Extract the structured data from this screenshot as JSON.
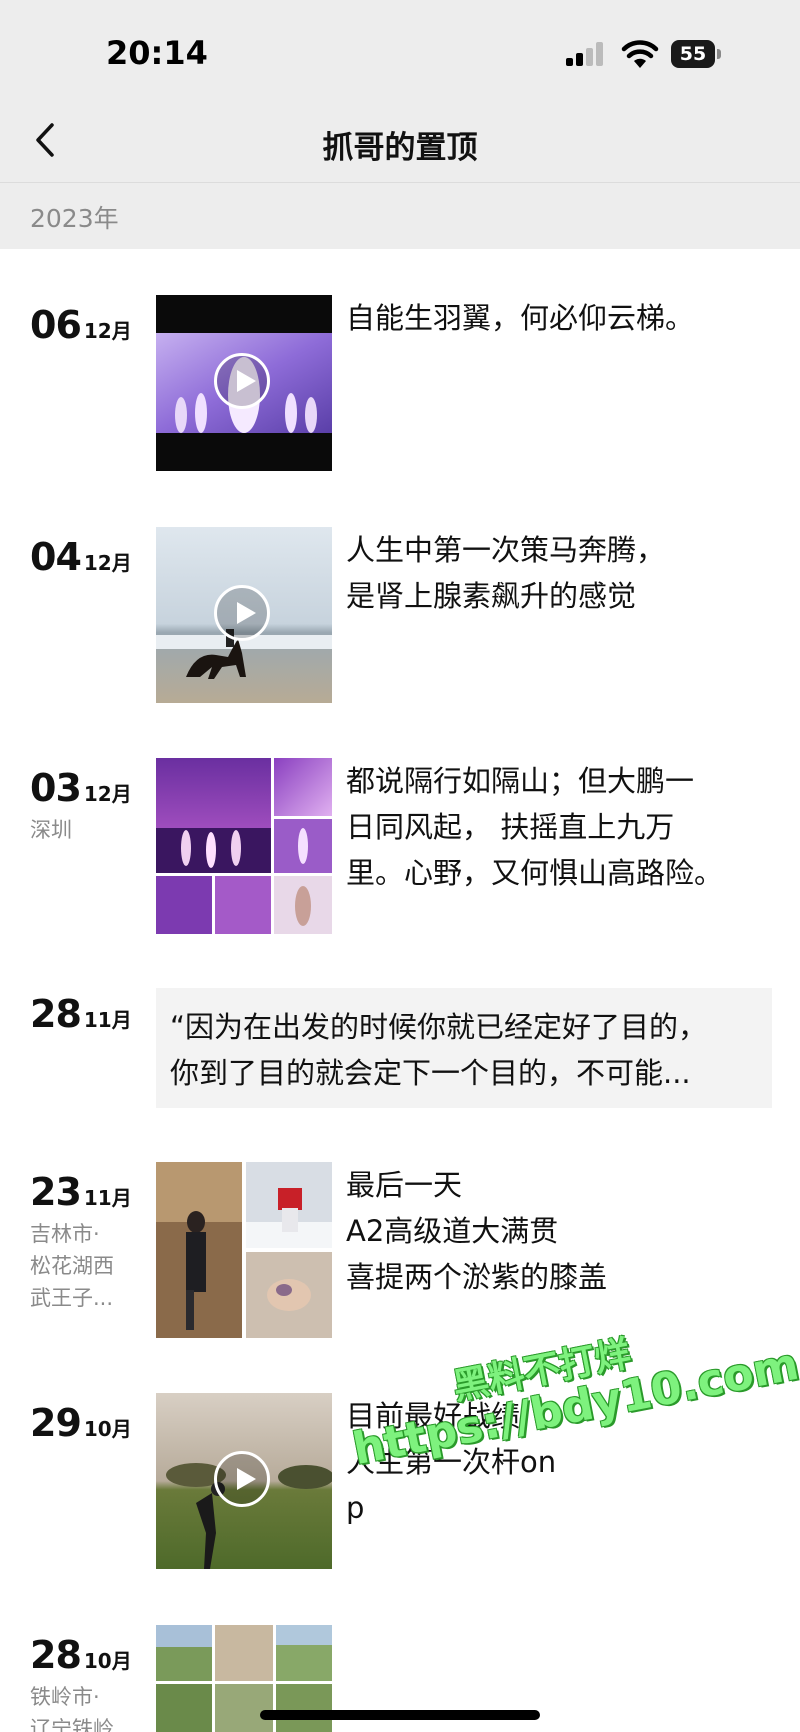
{
  "status": {
    "time": "20:14",
    "battery": "55"
  },
  "nav": {
    "title": "抓哥的置顶"
  },
  "timeline": {
    "year": "2023年",
    "entries": [
      {
        "day": "06",
        "month": "12月",
        "location": "",
        "text": [
          "自能生羽翼，何必仰云梯。"
        ],
        "media": "video"
      },
      {
        "day": "04",
        "month": "12月",
        "location": "",
        "text": [
          "人生中第一次策马奔腾，",
          "是肾上腺素飙升的感觉"
        ],
        "media": "video"
      },
      {
        "day": "03",
        "month": "12月",
        "location": "深圳",
        "text": [
          "都说隔行如隔山；但大鹏一",
          "日同风起， 扶摇直上九万",
          "里。心野，又何惧山高路险。"
        ],
        "media": "grid"
      },
      {
        "day": "28",
        "month": "11月",
        "location": "",
        "text": [
          "“因为在出发的时候你就已经定好了目的，",
          "你到了目的就会定下一个目的，不可能..."
        ],
        "media": "quote"
      },
      {
        "day": "23",
        "month": "11月",
        "location": [
          "吉林市·",
          "松花湖西",
          "武王子..."
        ],
        "text": [
          "最后一天",
          "A2高级道大满贯",
          "喜提两个淤紫的膝盖"
        ],
        "media": "grid"
      },
      {
        "day": "29",
        "month": "10月",
        "location": "",
        "text": [
          "目前最好战绩",
          "人生第一次杆on",
          "p"
        ],
        "media": "video"
      },
      {
        "day": "28",
        "month": "10月",
        "location": [
          "铁岭市·",
          "辽宁铁岭"
        ],
        "text": [],
        "media": "grid"
      }
    ]
  },
  "watermark": {
    "line1": "黑料不打烊",
    "line2": "https://bdy10.com"
  },
  "colors": {
    "header_bg": "#ededed",
    "watermark_green": "#7ef27e"
  }
}
